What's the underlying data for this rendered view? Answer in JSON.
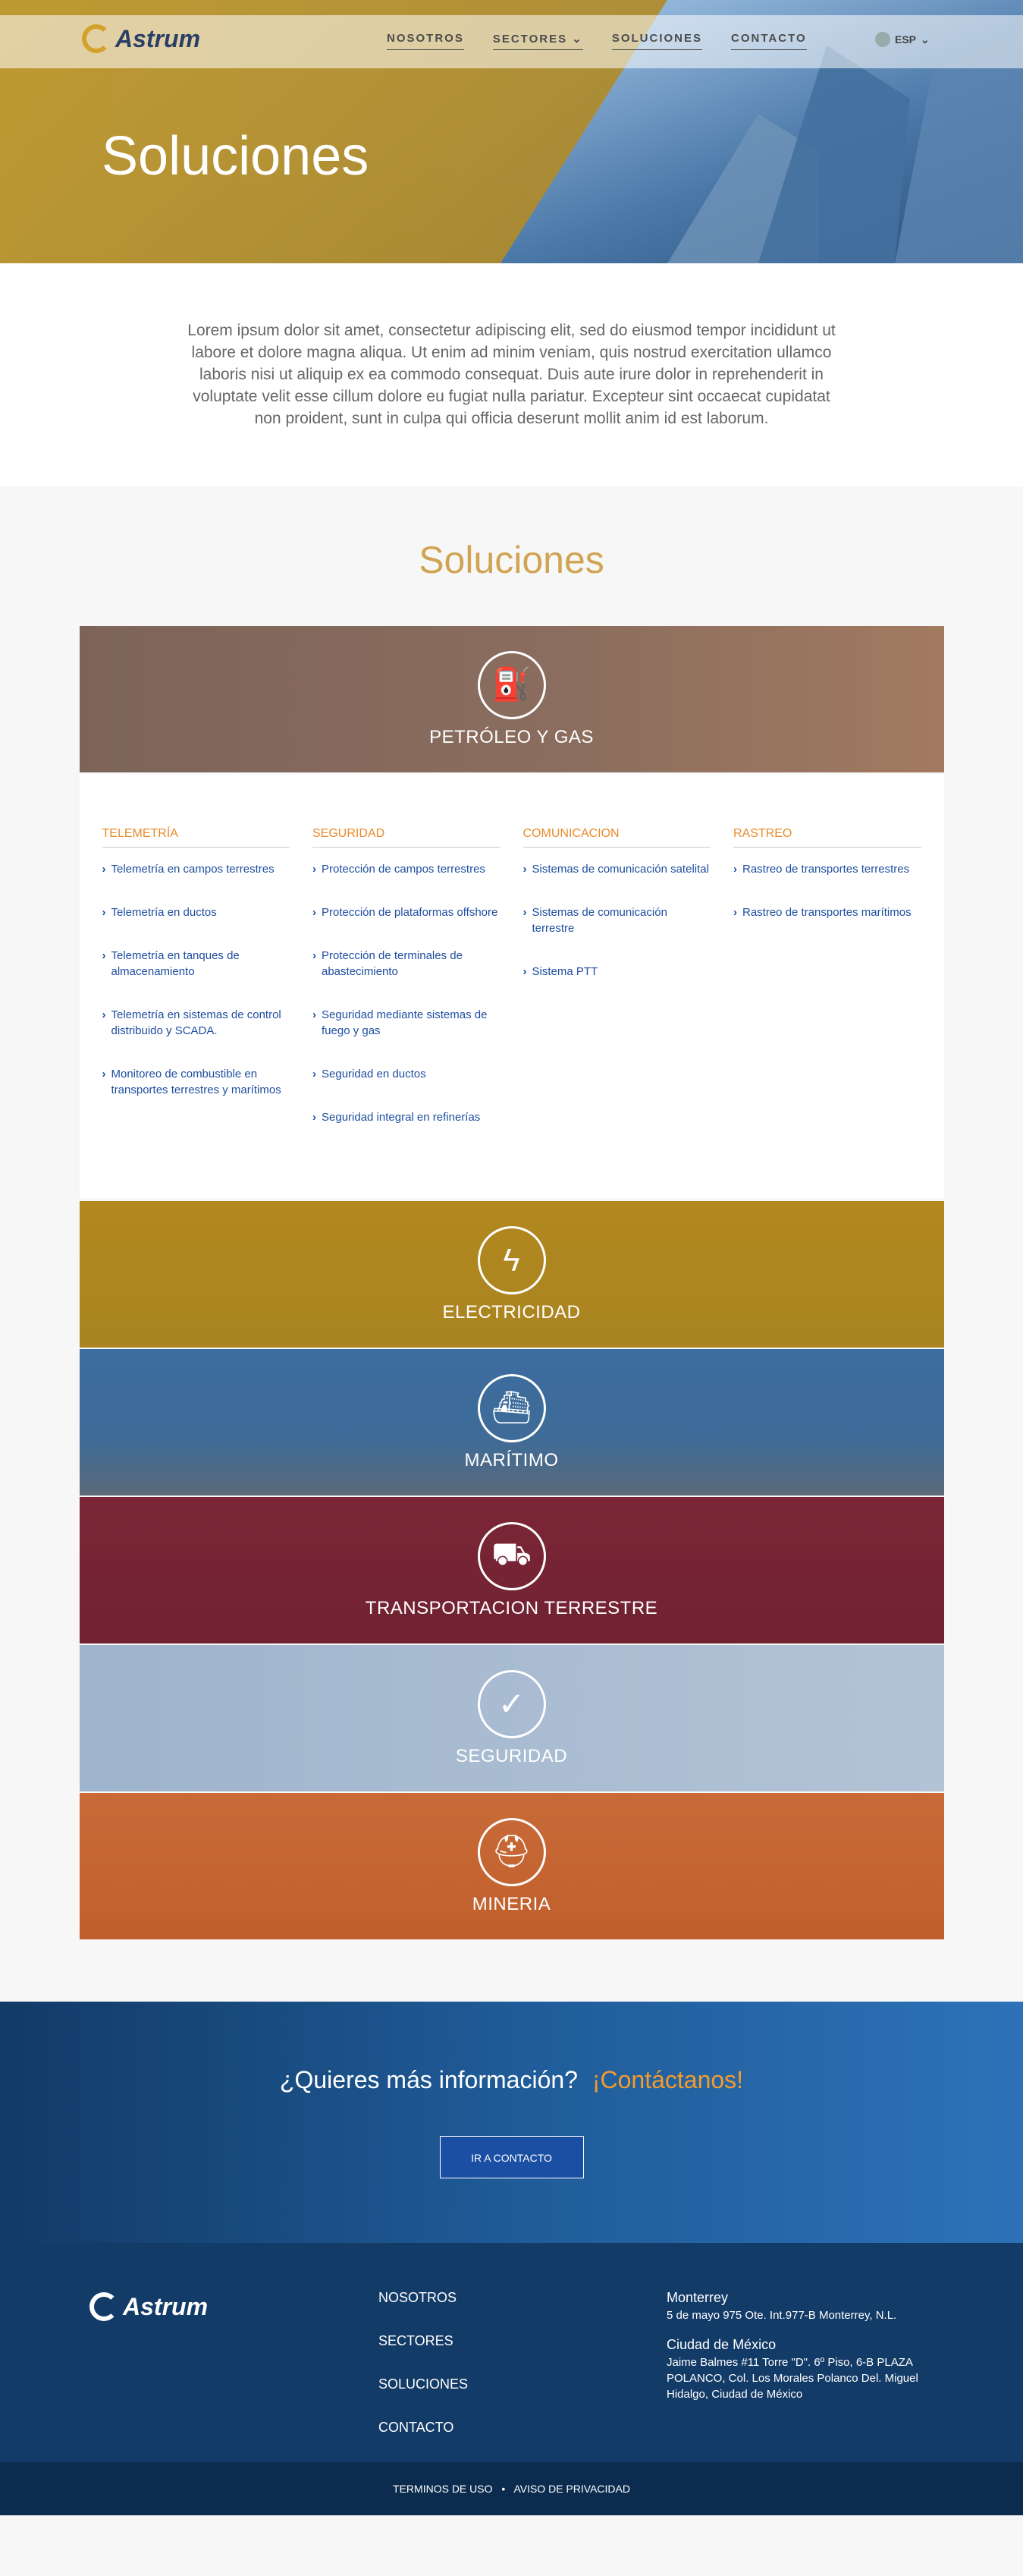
{
  "header": {
    "logo_text": "Astrum",
    "nav": [
      "NOSOTROS",
      "SECTORES",
      "SOLUCIONES",
      "CONTACTO"
    ],
    "lang": "ESP",
    "hero_title": "Soluciones"
  },
  "intro": {
    "text": "Lorem ipsum dolor sit amet, consectetur adipiscing elit, sed do eiusmod tempor incididunt ut labore et dolore magna aliqua. Ut enim ad minim veniam, quis nostrud exercitation ullamco laboris nisi ut aliquip ex ea commodo consequat. Duis aute irure dolor in reprehenderit in voluptate velit esse cillum dolore eu fugiat nulla pariatur. Excepteur sint occaecat cupidatat non proident, sunt in culpa qui officia deserunt mollit anim id est laborum."
  },
  "solutions": {
    "title": "Soluciones",
    "cards": [
      {
        "label": "PETRÓLEO Y GAS",
        "icon": "oil-pump-icon"
      },
      {
        "label": "ELECTRICIDAD",
        "icon": "lightning-icon"
      },
      {
        "label": "MARÍTIMO",
        "icon": "ship-icon"
      },
      {
        "label": "TRANSPORTACION TERRESTRE",
        "icon": "truck-icon"
      },
      {
        "label": "SEGURIDAD",
        "icon": "shield-icon"
      },
      {
        "label": "MINERIA",
        "icon": "helmet-icon"
      }
    ],
    "submenu": [
      {
        "heading": "TELEMETRÍA",
        "items": [
          "Telemetría en campos terrestres",
          "Telemetría en ductos",
          "Telemetría en tanques de almacenamiento",
          "Telemetría en sistemas de control distribuido y SCADA.",
          "Monitoreo de combustible en transportes terrestres y marítimos"
        ]
      },
      {
        "heading": "SEGURIDAD",
        "items": [
          "Protección de campos terrestres",
          "Protección de plataformas offshore",
          "Protección de terminales de abastecimiento",
          "Seguridad mediante sistemas de fuego y gas",
          "Seguridad en ductos",
          "Seguridad integral en refinerías"
        ]
      },
      {
        "heading": "COMUNICACION",
        "items": [
          "Sistemas de comunicación satelital",
          "Sistemas de comunicación terrestre",
          "Sistema PTT"
        ]
      },
      {
        "heading": "RASTREO",
        "items": [
          "Rastreo de transportes terrestres",
          "Rastreo de transportes marítimos"
        ]
      }
    ]
  },
  "cta": {
    "question": "¿Quieres más información?",
    "highlight": "¡Contáctanos!",
    "button": "IR A CONTACTO"
  },
  "footer": {
    "logo_text": "Astrum",
    "nav": [
      "NOSOTROS",
      "SECTORES",
      "SOLUCIONES",
      "CONTACTO"
    ],
    "offices": [
      {
        "city": "Monterrey",
        "address": "5 de mayo 975 Ote. Int.977-B Monterrey, N.L."
      },
      {
        "city": "Ciudad de México",
        "address": "Jaime Balmes #11 Torre \"D\". 6º Piso, 6-B PLAZA POLANCO, Col. Los Morales Polanco Del. Miguel Hidalgo, Ciudad de México"
      }
    ],
    "legal": [
      "TERMINOS DE USO",
      "AVISO DE PRIVACIDAD"
    ],
    "legal_sep": "•"
  },
  "colors": {
    "accent_gold": "#d0a452",
    "accent_orange": "#e98b2a",
    "link_blue": "#1e4ea0",
    "footer_navy": "#133b67"
  }
}
